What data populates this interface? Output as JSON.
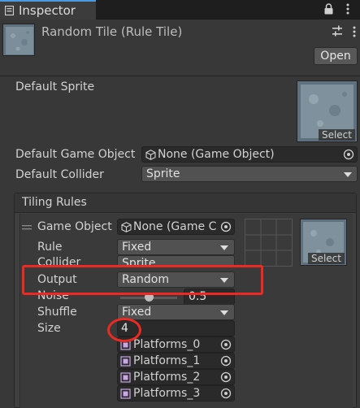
{
  "window": {
    "tab_label": "Inspector"
  },
  "header": {
    "title": "Random Tile (Rule Tile)",
    "open_button": "Open"
  },
  "fields": {
    "default_sprite": {
      "label": "Default Sprite",
      "select_label": "Select"
    },
    "default_game_object": {
      "label": "Default Game Object",
      "value": "None (Game Object)"
    },
    "default_collider": {
      "label": "Default Collider",
      "value": "Sprite"
    }
  },
  "tiling_rules": {
    "title": "Tiling Rules",
    "game_object": {
      "label": "Game Object",
      "value": "None (Game C"
    },
    "rule": {
      "label": "Rule",
      "value": "Fixed"
    },
    "collider": {
      "label": "Collider",
      "value": "Sprite"
    },
    "output": {
      "label": "Output",
      "value": "Random"
    },
    "noise": {
      "label": "Noise",
      "value": "0.5",
      "level": 0.5
    },
    "shuffle": {
      "label": "Shuffle",
      "value": "Fixed"
    },
    "size": {
      "label": "Size",
      "value": "4"
    },
    "sprites": [
      "Platforms_0",
      "Platforms_1",
      "Platforms_2",
      "Platforms_3"
    ],
    "preview_select_label": "Select"
  },
  "colors": {
    "annotation": "#ec2a22",
    "accent_tab": "#4a9ae0",
    "background": "#383838"
  },
  "icons": {
    "tab": "inspector-icon",
    "lock": "lock-icon",
    "menu": "kebab-menu-icon",
    "settings": "preset-settings-icon",
    "object_field": "cube-icon",
    "object_picker": "circle-dot-picker-icon",
    "sprite_field": "sprite-tile-icon",
    "rule_grid": "neighbor-grid-icon",
    "drag": "drag-handle-icon"
  }
}
